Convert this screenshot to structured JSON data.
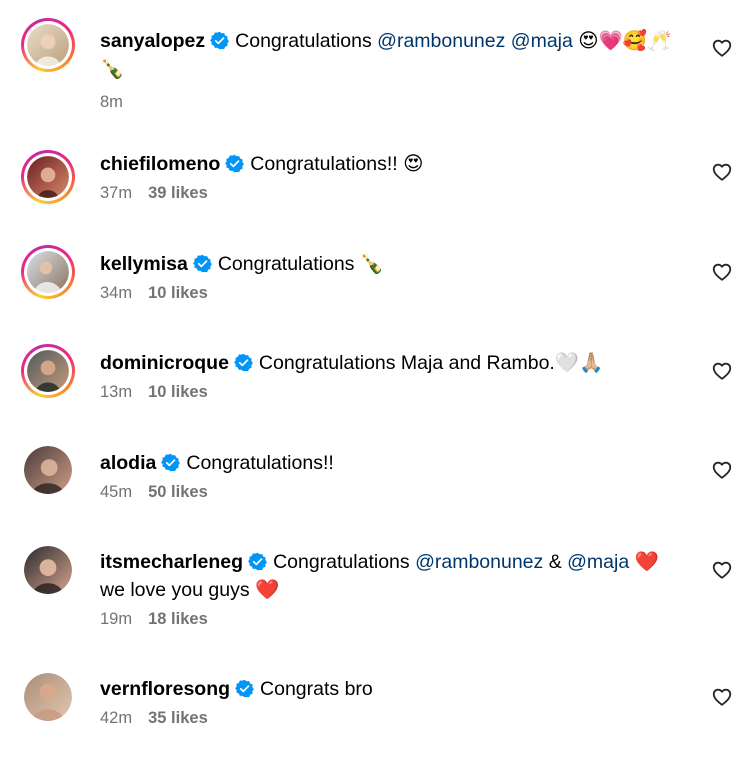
{
  "comments": [
    {
      "username": "sanyalopez",
      "segments": [
        {
          "type": "text",
          "value": "Congratulations "
        },
        {
          "type": "mention",
          "value": "@rambonunez"
        },
        {
          "type": "text",
          "value": " "
        },
        {
          "type": "mention",
          "value": "@maja"
        },
        {
          "type": "text",
          "value": " 😍💗🥰🥂🍾"
        }
      ],
      "time": "8m",
      "likes": "",
      "story_ring": true,
      "avatar_colors": [
        "#e9ddc9",
        "#b9a07c"
      ]
    },
    {
      "username": "chiefilomeno",
      "segments": [
        {
          "type": "text",
          "value": "Congratulations!! 😍"
        }
      ],
      "time": "37m",
      "likes": "39 likes",
      "story_ring": true,
      "avatar_colors": [
        "#6b1e22",
        "#d98a6a"
      ]
    },
    {
      "username": "kellymisa",
      "segments": [
        {
          "type": "text",
          "value": "Congratulations 🍾"
        }
      ],
      "time": "34m",
      "likes": "10 likes",
      "story_ring": true,
      "avatar_colors": [
        "#d9e0e6",
        "#8a7460"
      ]
    },
    {
      "username": "dominicroque",
      "segments": [
        {
          "type": "text",
          "value": "Congratulations Maja and Rambo.🤍🙏🏼"
        }
      ],
      "time": "13m",
      "likes": "10 likes",
      "story_ring": true,
      "avatar_colors": [
        "#4f5a5c",
        "#c69a7c"
      ]
    },
    {
      "username": "alodia",
      "segments": [
        {
          "type": "text",
          "value": "Congratulations!!"
        }
      ],
      "time": "45m",
      "likes": "50 likes",
      "story_ring": false,
      "avatar_colors": [
        "#4a3a3a",
        "#cfa088"
      ]
    },
    {
      "username": "itsmecharleneg",
      "segments": [
        {
          "type": "text",
          "value": "Congratulations "
        },
        {
          "type": "mention",
          "value": "@rambonunez"
        },
        {
          "type": "text",
          "value": " & "
        },
        {
          "type": "mention",
          "value": "@maja"
        },
        {
          "type": "text",
          "value": " ❤️we love you guys ❤️"
        }
      ],
      "time": "19m",
      "likes": "18 likes",
      "story_ring": false,
      "avatar_colors": [
        "#2a2a2e",
        "#d7a48c"
      ]
    },
    {
      "username": "vernfloresong",
      "segments": [
        {
          "type": "text",
          "value": "Congrats bro"
        }
      ],
      "time": "42m",
      "likes": "35 likes",
      "story_ring": false,
      "avatar_colors": [
        "#a88d78",
        "#e5c7b0"
      ]
    }
  ],
  "colors": {
    "mention": "#00376b",
    "meta": "#737373",
    "verified": "#0095f6"
  }
}
